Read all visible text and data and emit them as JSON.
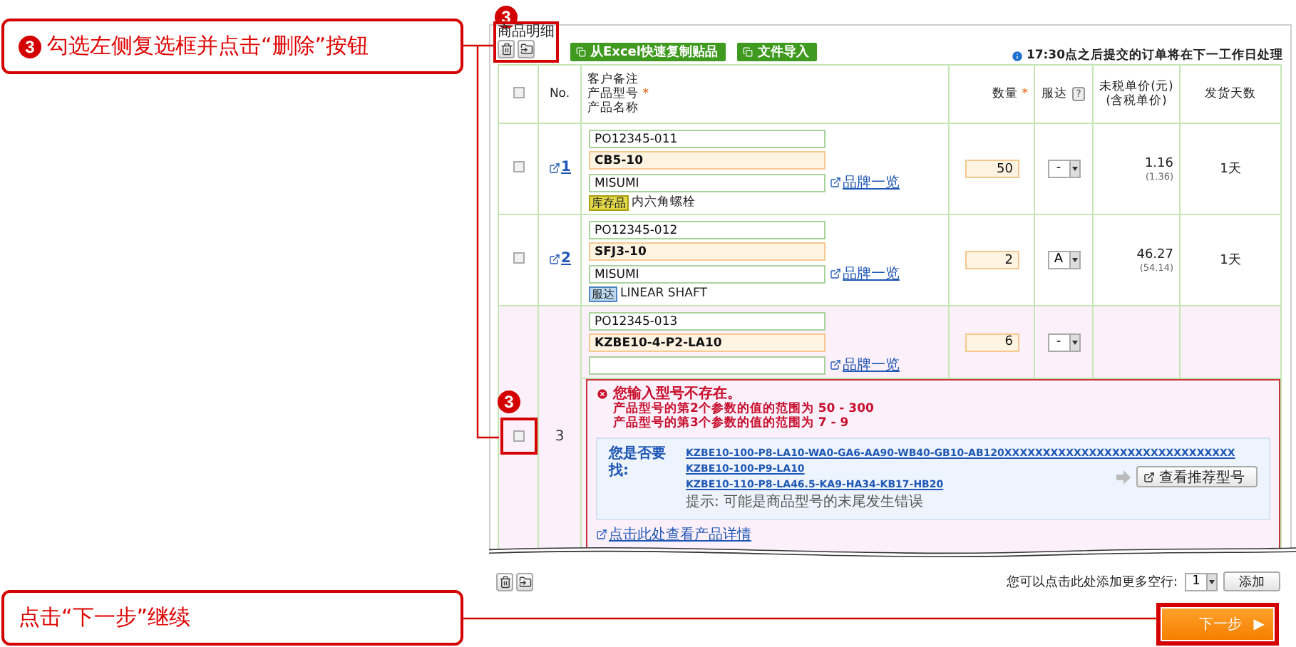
{
  "callouts": [
    {
      "marker": "3",
      "text": "勾选左侧复选框并点击“删除”按钮"
    },
    {
      "text": "点击“下一步”继续"
    }
  ],
  "panel": {
    "marker": "3",
    "title": "商品明细",
    "actions": [
      "从Excel快速复制贴品",
      "文件导入"
    ],
    "notice": "17:30点之后提交的订单将在下一工作日处理"
  },
  "table": {
    "select_all": false,
    "required_mark": "*",
    "columns": [
      {
        "lines": [
          {
            "text": "No.",
            "required": false
          }
        ]
      },
      {
        "lines": [
          {
            "text": "客户备注",
            "required": false
          },
          {
            "text": "产品型号",
            "required": true
          },
          {
            "text": "产品名称",
            "required": false
          }
        ]
      },
      {
        "lines": [
          {
            "text": "数量",
            "required": true
          }
        ]
      },
      {
        "lines": [
          {
            "text": "服达",
            "required": false
          }
        ],
        "help": "?"
      },
      {
        "lines": [
          {
            "text": "未税单价(元)",
            "required": false
          },
          {
            "text": "(含税单价)",
            "required": false
          }
        ]
      },
      {
        "lines": [
          {
            "text": "发货天数",
            "required": false
          }
        ]
      }
    ],
    "rows": [
      {
        "selected": false,
        "highlighted": false,
        "no": "1",
        "note": "PO12345-011",
        "part": "CB5-10",
        "brand": "MISUMI",
        "brand_link": "品牌一览",
        "tag": {
          "kind": "stock",
          "text": "库存品"
        },
        "name": "内六角螺栓",
        "qty": "50",
        "delivery": "-",
        "price": "1.16",
        "tax_price": "(1.36)",
        "days": "1天"
      },
      {
        "selected": false,
        "highlighted": false,
        "no": "2",
        "note": "PO12345-012",
        "part": "SFJ3-10",
        "brand": "MISUMI",
        "brand_link": "品牌一览",
        "tag": {
          "kind": "service",
          "text": "服达"
        },
        "name": "LINEAR SHAFT",
        "qty": "2",
        "delivery": "A",
        "price": "46.27",
        "tax_price": "(54.14)",
        "days": "1天"
      },
      {
        "selected": false,
        "highlighted": true,
        "marker": "3",
        "no": "3",
        "note": "PO12345-013",
        "part": "KZBE10-4-P2-LA10",
        "brand_link": "品牌一览",
        "qty": "6",
        "delivery": "-",
        "error": {
          "title": "您输入型号不存在。",
          "messages": [
            "产品型号的第2个参数的值的范围为 50 - 300",
            "产品型号的第3个参数的值的范围为 7 - 9"
          ],
          "suggest_label": "您是否要找:",
          "suggestions": [
            "KZBE10-100-P8-LA10-WA0-GA6-AA90-WB40-GB10-AB120XXXXXXXXXXXXXXXXXXXXXXXXXXXXXX",
            "KZBE10-100-P9-LA10",
            "KZBE10-110-P8-LA46.5-KA9-HA34-KB17-HB20"
          ],
          "hint": "提示: 可能是商品型号的末尾发生错误",
          "suggest_button": "查看推荐型号",
          "detail_link": "点击此处查看产品详情"
        }
      }
    ]
  },
  "footer": {
    "add_label": "您可以点击此处添加更多空行:",
    "add_count": "1",
    "add_button": "添加",
    "next_button": "下一步",
    "next_arrow": "▶"
  }
}
